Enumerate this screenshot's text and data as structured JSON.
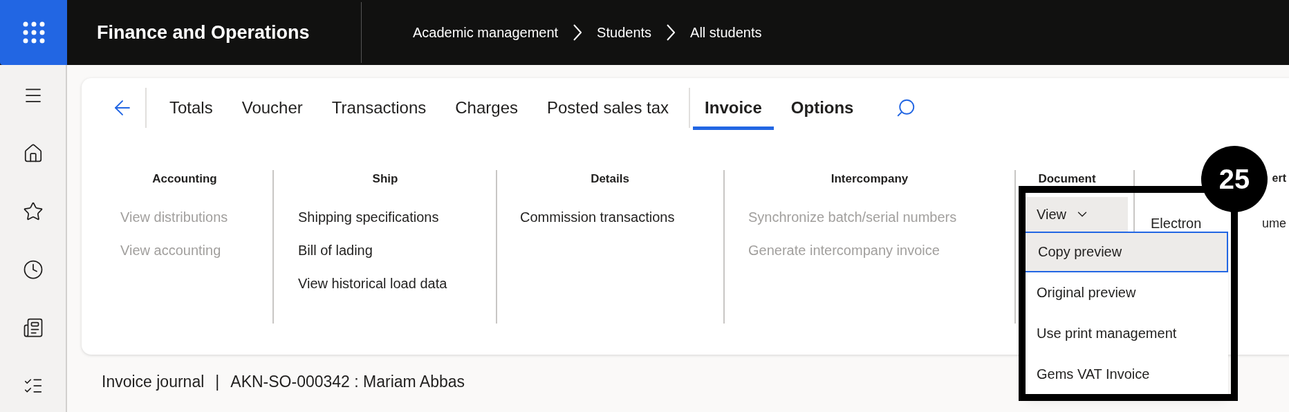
{
  "app": {
    "title": "Finance and Operations"
  },
  "breadcrumb": [
    "Academic management",
    "Students",
    "All students"
  ],
  "action_pane": {
    "items": [
      {
        "label": "Totals",
        "kind": "action",
        "selected": false
      },
      {
        "label": "Voucher",
        "kind": "action",
        "selected": false
      },
      {
        "label": "Transactions",
        "kind": "action",
        "selected": false
      },
      {
        "label": "Charges",
        "kind": "action",
        "selected": false
      },
      {
        "label": "Posted sales tax",
        "kind": "action",
        "selected": false
      },
      {
        "label": "Invoice",
        "kind": "tab",
        "selected": true
      },
      {
        "label": "Options",
        "kind": "tab",
        "selected": false
      }
    ]
  },
  "groups": [
    {
      "title": "Accounting",
      "kind": "list",
      "items": [
        {
          "label": "View distributions",
          "disabled": true
        },
        {
          "label": "View accounting",
          "disabled": true
        }
      ]
    },
    {
      "title": "Ship",
      "kind": "list",
      "items": [
        {
          "label": "Shipping specifications",
          "disabled": false
        },
        {
          "label": "Bill of lading",
          "disabled": false
        },
        {
          "label": "View historical load data",
          "disabled": false
        }
      ]
    },
    {
      "title": "Details",
      "kind": "list",
      "items": [
        {
          "label": "Commission transactions",
          "disabled": false
        }
      ]
    },
    {
      "title": "Intercompany",
      "kind": "list",
      "items": [
        {
          "label": "Synchronize batch/serial numbers",
          "disabled": true
        },
        {
          "label": "Generate intercompany invoice",
          "disabled": true
        }
      ]
    },
    {
      "title": "Document",
      "kind": "dropdown",
      "button": "View",
      "menu": [
        {
          "label": "Copy preview",
          "selected": true
        },
        {
          "label": "Original preview",
          "selected": false
        },
        {
          "label": "Use print management",
          "selected": false
        },
        {
          "label": "Gems VAT Invoice",
          "selected": false
        }
      ]
    },
    {
      "title": "ert",
      "kind": "clipped",
      "fragments": [
        "Electron",
        "ume"
      ]
    }
  ],
  "caption": {
    "form": "Invoice journal",
    "separator": "|",
    "record": "AKN-SO-000342 : Mariam Abbas"
  },
  "callout": {
    "number": "25"
  }
}
